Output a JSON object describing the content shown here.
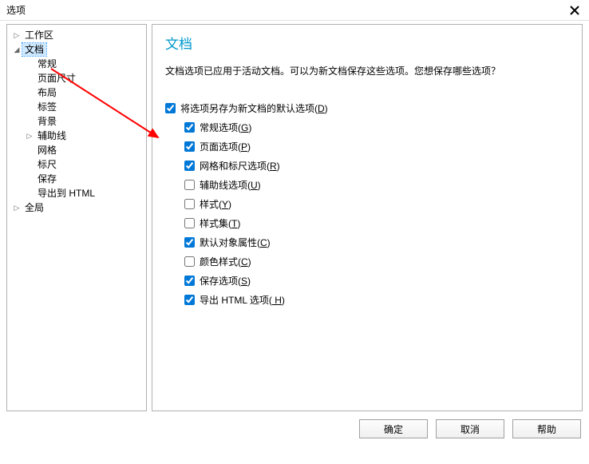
{
  "window": {
    "title": "选项"
  },
  "sidebar": {
    "items": [
      {
        "label": "工作区",
        "indent": 0,
        "arrow": "right",
        "selected": false
      },
      {
        "label": "文档",
        "indent": 0,
        "arrow": "down",
        "selected": true
      },
      {
        "label": "常规",
        "indent": 1,
        "arrow": "",
        "selected": false
      },
      {
        "label": "页面尺寸",
        "indent": 1,
        "arrow": "",
        "selected": false
      },
      {
        "label": "布局",
        "indent": 1,
        "arrow": "",
        "selected": false
      },
      {
        "label": "标签",
        "indent": 1,
        "arrow": "",
        "selected": false
      },
      {
        "label": "背景",
        "indent": 1,
        "arrow": "",
        "selected": false
      },
      {
        "label": "辅助线",
        "indent": 1,
        "arrow": "right",
        "selected": false
      },
      {
        "label": "网格",
        "indent": 1,
        "arrow": "",
        "selected": false
      },
      {
        "label": "标尺",
        "indent": 1,
        "arrow": "",
        "selected": false
      },
      {
        "label": "保存",
        "indent": 1,
        "arrow": "",
        "selected": false
      },
      {
        "label": "导出到 HTML",
        "indent": 1,
        "arrow": "",
        "selected": false
      },
      {
        "label": "全局",
        "indent": 0,
        "arrow": "right",
        "selected": false
      }
    ]
  },
  "panel": {
    "title": "文档",
    "description": "文档选项已应用于活动文档。可以为新文档保存这些选项。您想保存哪些选项？",
    "master": {
      "label": "将选项另存为新文档的默认选项",
      "accel": "D",
      "checked": true,
      "indent": 0
    },
    "opts": [
      {
        "label": "常规选项",
        "accel": "G",
        "checked": true
      },
      {
        "label": "页面选项",
        "accel": "P",
        "checked": true
      },
      {
        "label": "网格和标尺选项",
        "accel": "R",
        "checked": true
      },
      {
        "label": "辅助线选项",
        "accel": "U",
        "checked": false
      },
      {
        "label": "样式",
        "accel": "Y",
        "checked": false
      },
      {
        "label": "样式集",
        "accel": "T",
        "checked": false
      },
      {
        "label": "默认对象属性",
        "accel": "C",
        "checked": true
      },
      {
        "label": "颜色样式",
        "accel": "C",
        "checked": false
      },
      {
        "label": "保存选项",
        "accel": "S",
        "checked": true
      },
      {
        "label": "导出 HTML 选项",
        "accel": " H",
        "checked": true
      }
    ]
  },
  "buttons": {
    "ok": "确定",
    "cancel": "取消",
    "help": "帮助"
  }
}
